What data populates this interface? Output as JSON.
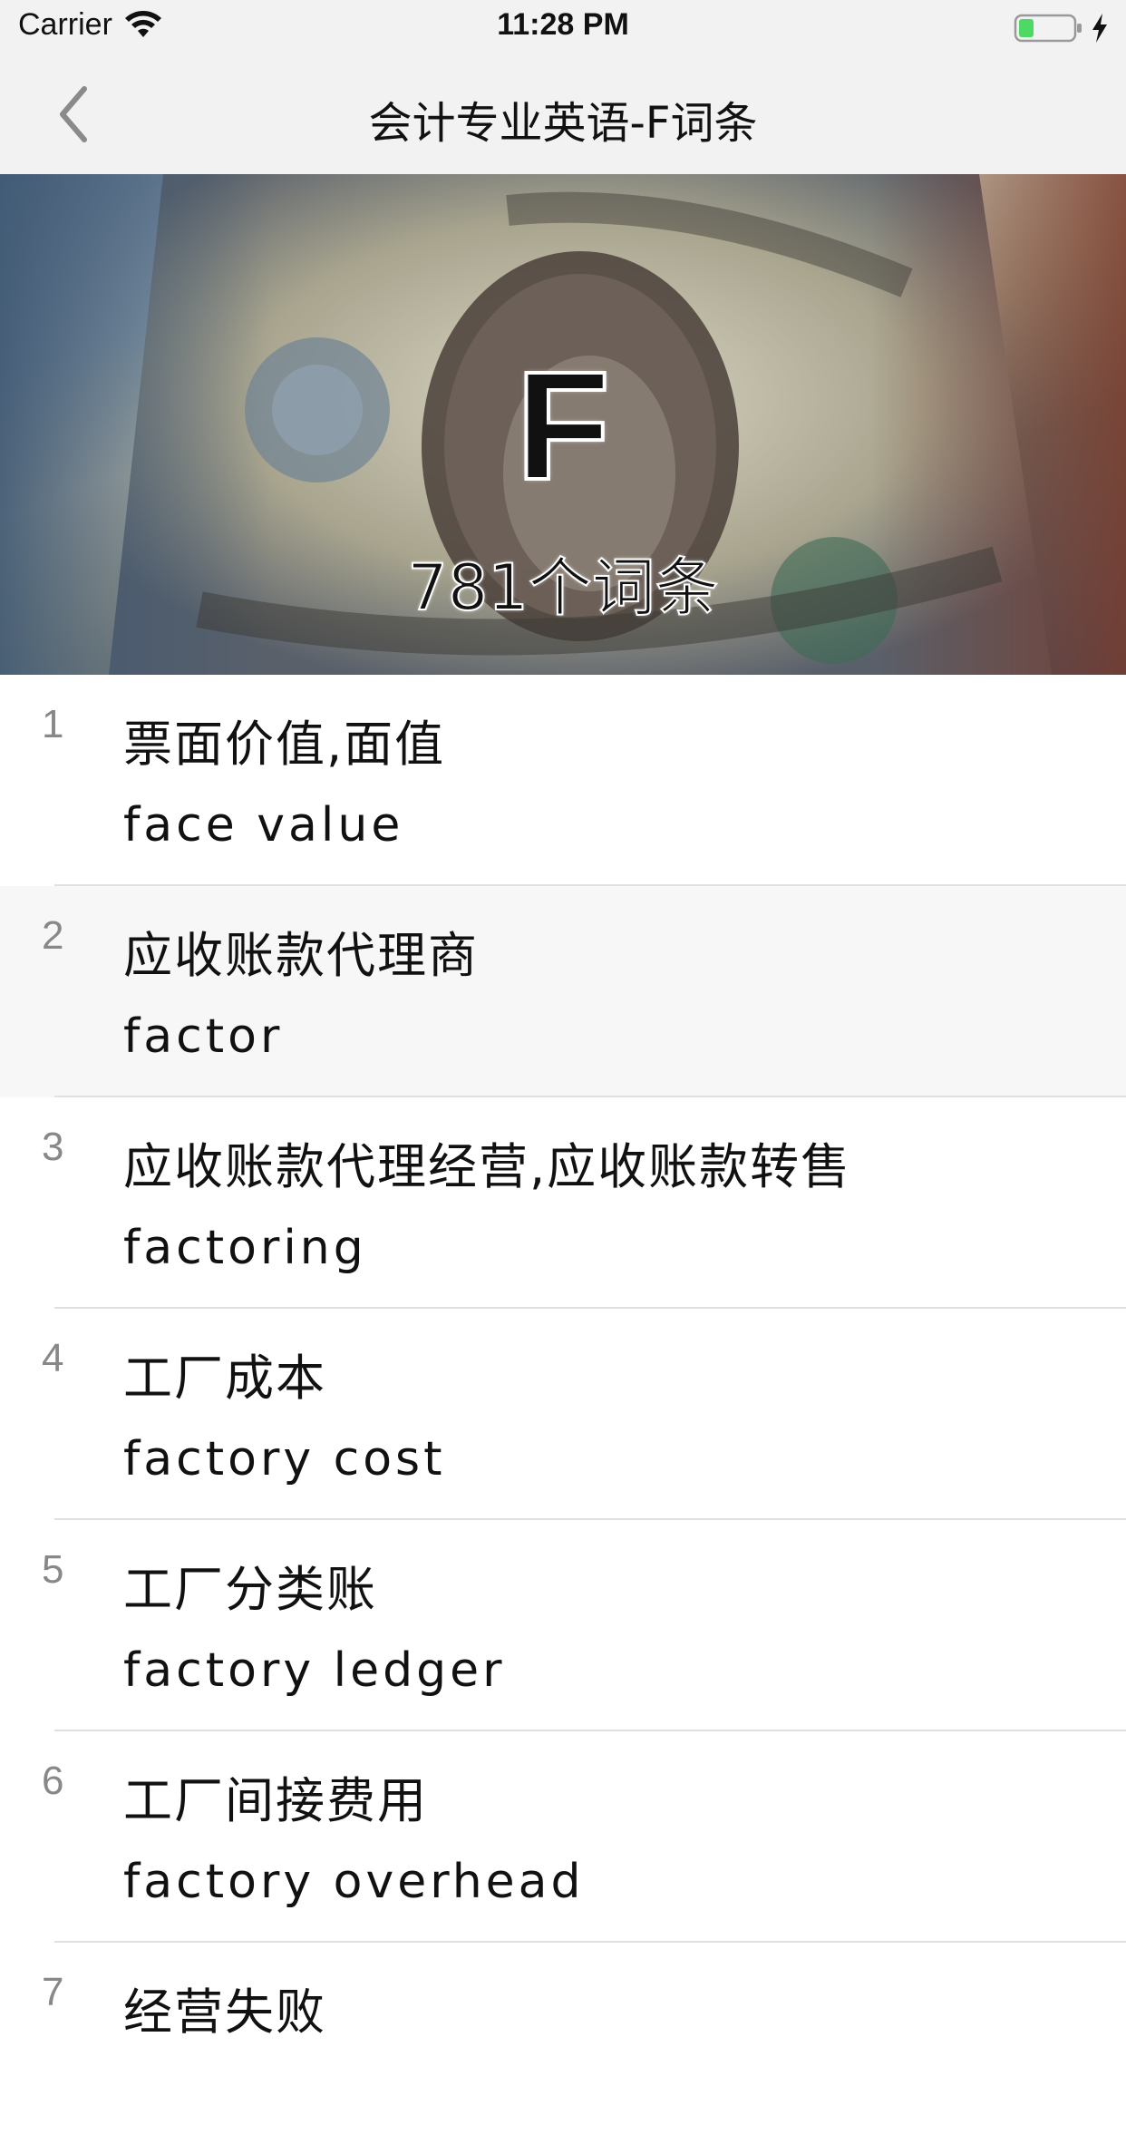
{
  "status_bar": {
    "carrier": "Carrier",
    "time": "11:28 PM",
    "battery_color": "#4cd964"
  },
  "nav": {
    "title": "会计专业英语-F词条",
    "back_icon": "chevron-left-icon"
  },
  "banner": {
    "letter": "F",
    "count_label": "781个词条"
  },
  "terms": [
    {
      "index": "1",
      "cn": "票面价值,面值",
      "en": "face value"
    },
    {
      "index": "2",
      "cn": "应收账款代理商",
      "en": "factor"
    },
    {
      "index": "3",
      "cn": "应收账款代理经营,应收账款转售",
      "en": "factoring"
    },
    {
      "index": "4",
      "cn": "工厂成本",
      "en": "factory cost"
    },
    {
      "index": "5",
      "cn": "工厂分类账",
      "en": "factory ledger"
    },
    {
      "index": "6",
      "cn": "工厂间接费用",
      "en": "factory overhead"
    },
    {
      "index": "7",
      "cn": "经营失败",
      "en": ""
    }
  ]
}
